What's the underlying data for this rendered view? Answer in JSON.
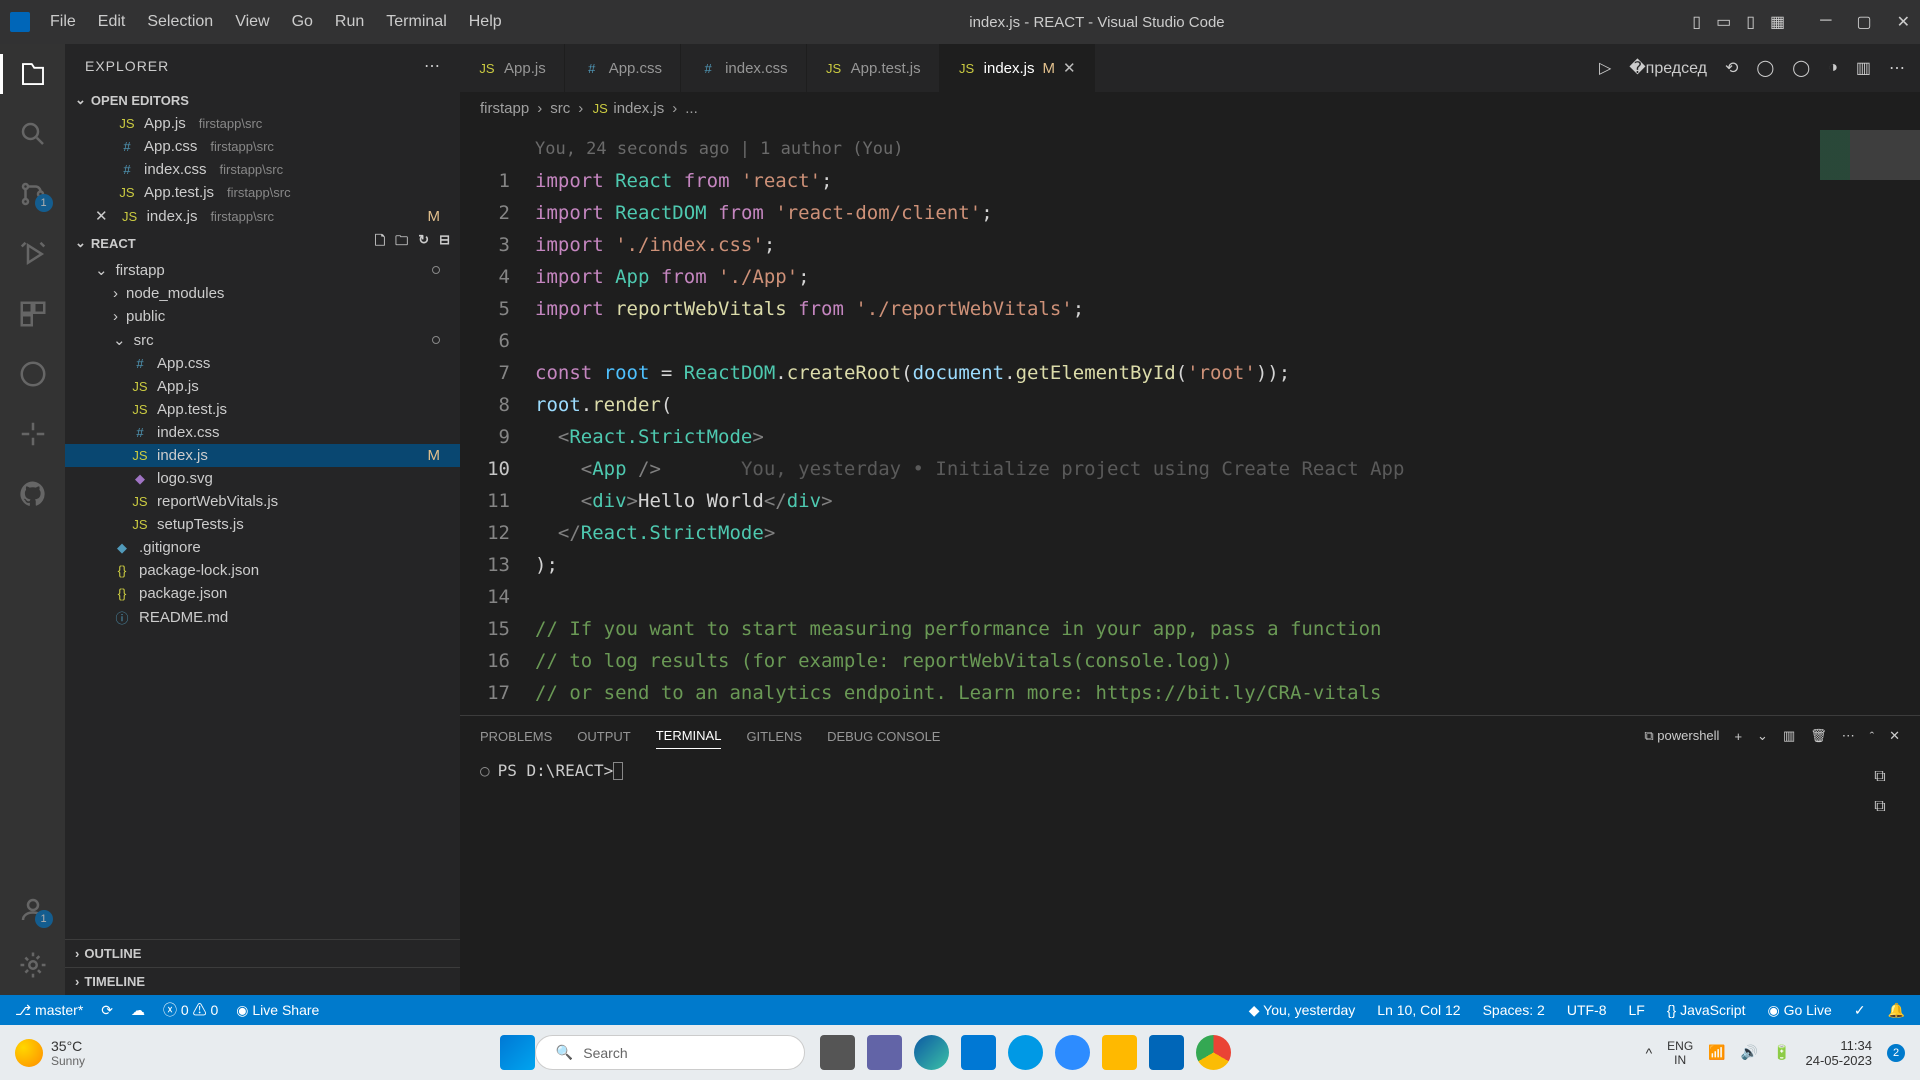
{
  "titlebar": {
    "menus": [
      "File",
      "Edit",
      "Selection",
      "View",
      "Go",
      "Run",
      "Terminal",
      "Help"
    ],
    "title": "index.js - REACT - Visual Studio Code"
  },
  "activity": {
    "scm_badge": "1",
    "account_badge": "1"
  },
  "sidebar": {
    "title": "EXPLORER",
    "sections": {
      "open_editors": "OPEN EDITORS",
      "project": "REACT",
      "outline": "OUTLINE",
      "timeline": "TIMELINE"
    },
    "open_editors": [
      {
        "icon": "JS",
        "name": "App.js",
        "path": "firstapp\\src"
      },
      {
        "icon": "#",
        "name": "App.css",
        "path": "firstapp\\src"
      },
      {
        "icon": "#",
        "name": "index.css",
        "path": "firstapp\\src"
      },
      {
        "icon": "JS",
        "name": "App.test.js",
        "path": "firstapp\\src"
      },
      {
        "icon": "JS",
        "name": "index.js",
        "path": "firstapp\\src",
        "modified": "M",
        "close": true
      }
    ],
    "tree": {
      "folder": "firstapp",
      "children": [
        "node_modules",
        "public",
        "src"
      ],
      "src_files": [
        {
          "icon": "#",
          "name": "App.css",
          "cls": "css"
        },
        {
          "icon": "JS",
          "name": "App.js",
          "cls": "js"
        },
        {
          "icon": "JS",
          "name": "App.test.js",
          "cls": "js"
        },
        {
          "icon": "#",
          "name": "index.css",
          "cls": "css"
        },
        {
          "icon": "JS",
          "name": "index.js",
          "cls": "js",
          "selected": true,
          "modified": "M"
        },
        {
          "icon": "◆",
          "name": "logo.svg",
          "cls": "svg"
        },
        {
          "icon": "JS",
          "name": "reportWebVitals.js",
          "cls": "js"
        },
        {
          "icon": "JS",
          "name": "setupTests.js",
          "cls": "js"
        }
      ],
      "root_files": [
        {
          "icon": "◆",
          "name": ".gitignore",
          "cls": "info"
        },
        {
          "icon": "{}",
          "name": "package-lock.json",
          "cls": "json"
        },
        {
          "icon": "{}",
          "name": "package.json",
          "cls": "json"
        },
        {
          "icon": "ⓘ",
          "name": "README.md",
          "cls": "info"
        }
      ]
    }
  },
  "tabs": [
    {
      "icon": "JS",
      "label": "App.js",
      "cls": "js"
    },
    {
      "icon": "#",
      "label": "App.css",
      "cls": "css"
    },
    {
      "icon": "#",
      "label": "index.css",
      "cls": "css"
    },
    {
      "icon": "JS",
      "label": "App.test.js",
      "cls": "js"
    },
    {
      "icon": "JS",
      "label": "index.js",
      "cls": "js",
      "active": true,
      "suffix": "M",
      "close": true
    }
  ],
  "breadcrumb": [
    "firstapp",
    "src",
    "index.js",
    "..."
  ],
  "editor": {
    "blame_header": "You, 24 seconds ago | 1 author (You)",
    "blame_inline": "You, yesterday • Initialize project using Create React App",
    "lines": [
      {
        "n": 1,
        "html": "<span class='kw'>import</span> <span class='cls'>React</span> <span class='kw'>from</span> <span class='str'>'react'</span><span class='punct'>;</span>"
      },
      {
        "n": 2,
        "html": "<span class='kw'>import</span> <span class='cls'>ReactDOM</span> <span class='kw'>from</span> <span class='str'>'react-dom/client'</span><span class='punct'>;</span>"
      },
      {
        "n": 3,
        "html": "<span class='kw'>import</span> <span class='str'>'./index.css'</span><span class='punct'>;</span>"
      },
      {
        "n": 4,
        "html": "<span class='kw'>import</span> <span class='cls'>App</span> <span class='kw'>from</span> <span class='str'>'./App'</span><span class='punct'>;</span>"
      },
      {
        "n": 5,
        "html": "<span class='kw'>import</span> <span class='fn'>reportWebVitals</span> <span class='kw'>from</span> <span class='str'>'./reportWebVitals'</span><span class='punct'>;</span>"
      },
      {
        "n": 6,
        "html": ""
      },
      {
        "n": 7,
        "html": "<span class='kw'>const</span> <span class='var'>root</span> <span class='punct'>=</span> <span class='cls'>ReactDOM</span><span class='punct'>.</span><span class='fn'>createRoot</span><span class='punct'>(</span><span class='prop'>document</span><span class='punct'>.</span><span class='fn'>getElementById</span><span class='punct'>(</span><span class='str'>'root'</span><span class='punct'>));</span>"
      },
      {
        "n": 8,
        "html": "<span class='prop'>root</span><span class='punct'>.</span><span class='fn'>render</span><span class='punct'>(</span>"
      },
      {
        "n": 9,
        "html": "  <span class='tag-bracket'>&lt;</span><span class='cls'>React.StrictMode</span><span class='tag-bracket'>&gt;</span>"
      },
      {
        "n": 10,
        "current": true,
        "html": "    <span class='tag-bracket'>&lt;</span><span class='cls'>App</span> <span class='tag-bracket'>/&gt;</span>       <span class='git-blame-inline'>You, yesterday • Initialize project using Create React App</span>"
      },
      {
        "n": 11,
        "html": "    <span class='tag-bracket'>&lt;</span><span class='cls'>div</span><span class='tag-bracket'>&gt;</span><span class='punct'>Hello World</span><span class='tag-bracket'>&lt;/</span><span class='cls'>div</span><span class='tag-bracket'>&gt;</span>"
      },
      {
        "n": 12,
        "html": "  <span class='tag-bracket'>&lt;/</span><span class='cls'>React.StrictMode</span><span class='tag-bracket'>&gt;</span>"
      },
      {
        "n": 13,
        "html": "<span class='punct'>);</span>"
      },
      {
        "n": 14,
        "html": ""
      },
      {
        "n": 15,
        "html": "<span class='comment'>// If you want to start measuring performance in your app, pass a function</span>"
      },
      {
        "n": 16,
        "html": "<span class='comment'>// to log results (for example: reportWebVitals(console.log))</span>"
      },
      {
        "n": 17,
        "html": "<span class='comment'>// or send to an analytics endpoint. Learn more: https://bit.ly/CRA-vitals</span>"
      }
    ]
  },
  "panel": {
    "tabs": [
      "PROBLEMS",
      "OUTPUT",
      "TERMINAL",
      "GITLENS",
      "DEBUG CONSOLE"
    ],
    "active_tab": "TERMINAL",
    "shell": "powershell",
    "prompt": "PS D:\\REACT> "
  },
  "statusbar": {
    "branch": "master*",
    "errors": "0",
    "warnings": "0",
    "live_share": "Live Share",
    "blame": "You, yesterday",
    "position": "Ln 10, Col 12",
    "spaces": "Spaces: 2",
    "encoding": "UTF-8",
    "eol": "LF",
    "language": "JavaScript",
    "go_live": "Go Live"
  },
  "taskbar": {
    "temp": "35°C",
    "weather": "Sunny",
    "search_placeholder": "Search",
    "lang1": "ENG",
    "lang2": "IN",
    "time": "11:34",
    "date": "24-05-2023",
    "notif_badge": "2"
  }
}
